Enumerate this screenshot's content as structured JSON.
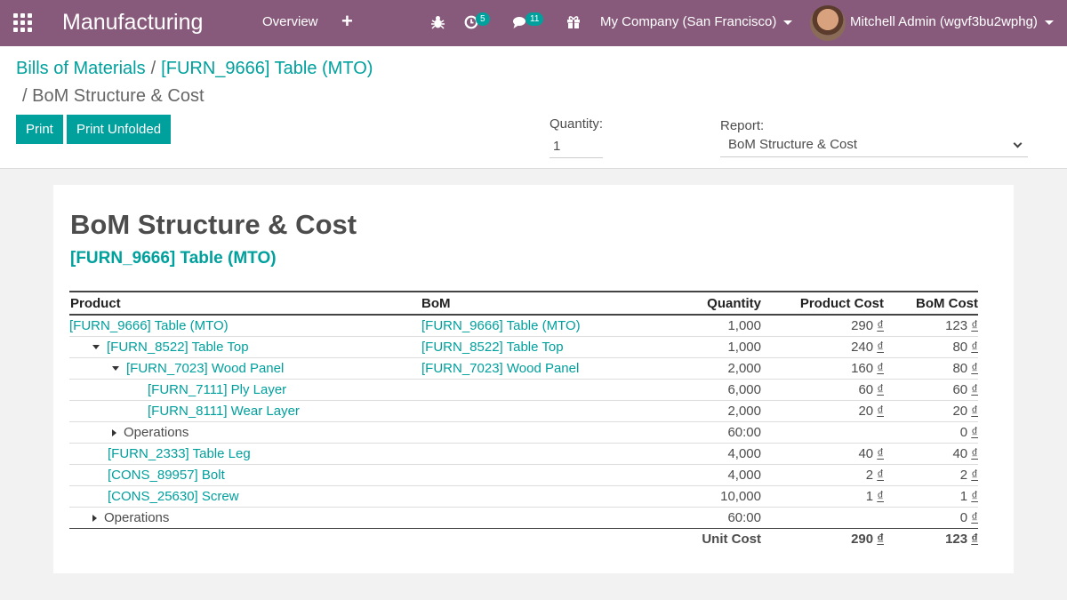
{
  "navbar": {
    "app_title": "Manufacturing",
    "menu_overview": "Overview",
    "plus": "+",
    "activity_badge": "5",
    "messages_badge": "11",
    "company": "My Company (San Francisco)",
    "user": "Mitchell Admin (wgvf3bu2wphg)",
    "bg_color": "#875a7b",
    "badge_color": "#00a09d"
  },
  "breadcrumb": {
    "item1": "Bills of Materials",
    "item2": "[FURN_9666] Table (MTO)",
    "current": "BoM Structure & Cost",
    "sep": "/"
  },
  "toolbar": {
    "print": "Print",
    "print_unfolded": "Print Unfolded",
    "quantity_label": "Quantity:",
    "quantity_value": "1",
    "report_label": "Report:",
    "report_value": "BoM Structure & Cost"
  },
  "report": {
    "title": "BoM Structure & Cost",
    "subtitle": "[FURN_9666] Table (MTO)",
    "columns": [
      "Product",
      "BoM",
      "Quantity",
      "Product Cost",
      "BoM Cost"
    ],
    "currency": "₫",
    "rows": [
      {
        "indent": 0,
        "toggle": "",
        "product": "[FURN_9666] Table (MTO)",
        "link": true,
        "bom": "[FURN_9666] Table (MTO)",
        "qty": "1,000",
        "pcost": "290",
        "bcost": "123"
      },
      {
        "indent": 1,
        "toggle": "down",
        "product": "[FURN_8522] Table Top",
        "link": true,
        "bom": "[FURN_8522] Table Top",
        "qty": "1,000",
        "pcost": "240",
        "bcost": "80"
      },
      {
        "indent": 2,
        "toggle": "down",
        "product": "[FURN_7023] Wood Panel",
        "link": true,
        "bom": "[FURN_7023] Wood Panel",
        "qty": "2,000",
        "pcost": "160",
        "bcost": "80"
      },
      {
        "indent": 3,
        "toggle": "",
        "product": "[FURN_7111] Ply Layer",
        "link": true,
        "bom": "",
        "qty": "6,000",
        "pcost": "60",
        "bcost": "60"
      },
      {
        "indent": 3,
        "toggle": "",
        "product": "[FURN_8111] Wear Layer",
        "link": true,
        "bom": "",
        "qty": "2,000",
        "pcost": "20",
        "bcost": "20"
      },
      {
        "indent": 2,
        "toggle": "right",
        "product": "Operations",
        "link": false,
        "bom": "",
        "qty": "60:00",
        "pcost": "",
        "bcost": "0"
      },
      {
        "indent": 1,
        "toggle": "",
        "product": "[FURN_2333] Table Leg",
        "link": true,
        "bom": "",
        "qty": "4,000",
        "pcost": "40",
        "bcost": "40"
      },
      {
        "indent": 1,
        "toggle": "",
        "product": "[CONS_89957] Bolt",
        "link": true,
        "bom": "",
        "qty": "4,000",
        "pcost": "2",
        "bcost": "2"
      },
      {
        "indent": 1,
        "toggle": "",
        "product": "[CONS_25630] Screw",
        "link": true,
        "bom": "",
        "qty": "10,000",
        "pcost": "1",
        "bcost": "1"
      },
      {
        "indent": 1,
        "toggle": "right",
        "product": "Operations",
        "link": false,
        "bom": "",
        "qty": "60:00",
        "pcost": "",
        "bcost": "0"
      }
    ],
    "footer": {
      "label": "Unit Cost",
      "pcost": "290",
      "bcost": "123"
    }
  }
}
